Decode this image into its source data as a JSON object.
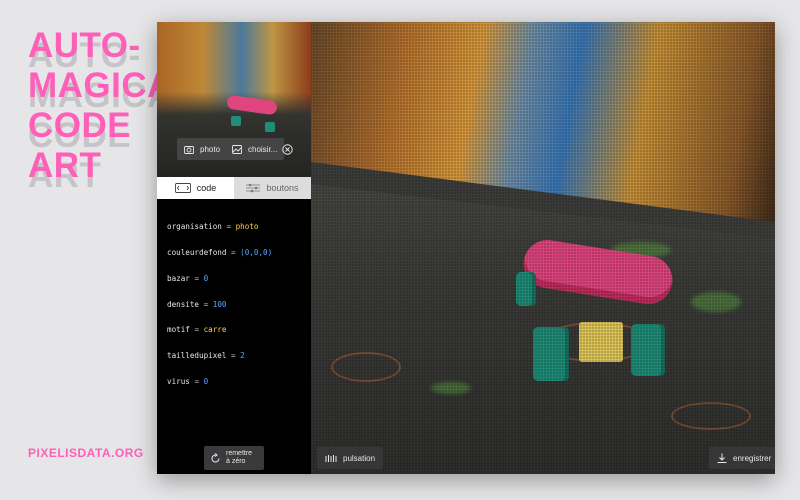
{
  "headline": {
    "lines": [
      "AUTO-",
      "MAGICAL",
      "CODE",
      "ART"
    ],
    "color": "#ff5fb8"
  },
  "site_url": "PIXELISDATA.ORG",
  "sidebar": {
    "photo_label": "photo",
    "choose_label": "choisir...",
    "close_icon": "close-circle-icon",
    "tabs": [
      {
        "label": "code",
        "icon": "code-icon",
        "active": true
      },
      {
        "label": "boutons",
        "icon": "sliders-icon",
        "active": false
      }
    ],
    "code": [
      {
        "name": "organisation",
        "value": "photo",
        "kind": "kw"
      },
      {
        "name": "couleurdefond",
        "value": "(0,0,0)",
        "kind": "num"
      },
      {
        "name": "bazar",
        "value": "0",
        "kind": "num"
      },
      {
        "name": "densite",
        "value": "100",
        "kind": "num"
      },
      {
        "name": "motif",
        "value": "carre",
        "kind": "kw"
      },
      {
        "name": "tailledupixel",
        "value": "2",
        "kind": "num"
      },
      {
        "name": "virus",
        "value": "0",
        "kind": "num"
      }
    ],
    "operator": "=",
    "reset_label_1": "remettre",
    "reset_label_2": "à zéro"
  },
  "canvas": {
    "pulse_label": "pulsation",
    "save_label": "enregistrer"
  },
  "colors": {
    "accent": "#ff5fb8",
    "keyword": "#ffd23f",
    "number": "#58a6ff"
  }
}
